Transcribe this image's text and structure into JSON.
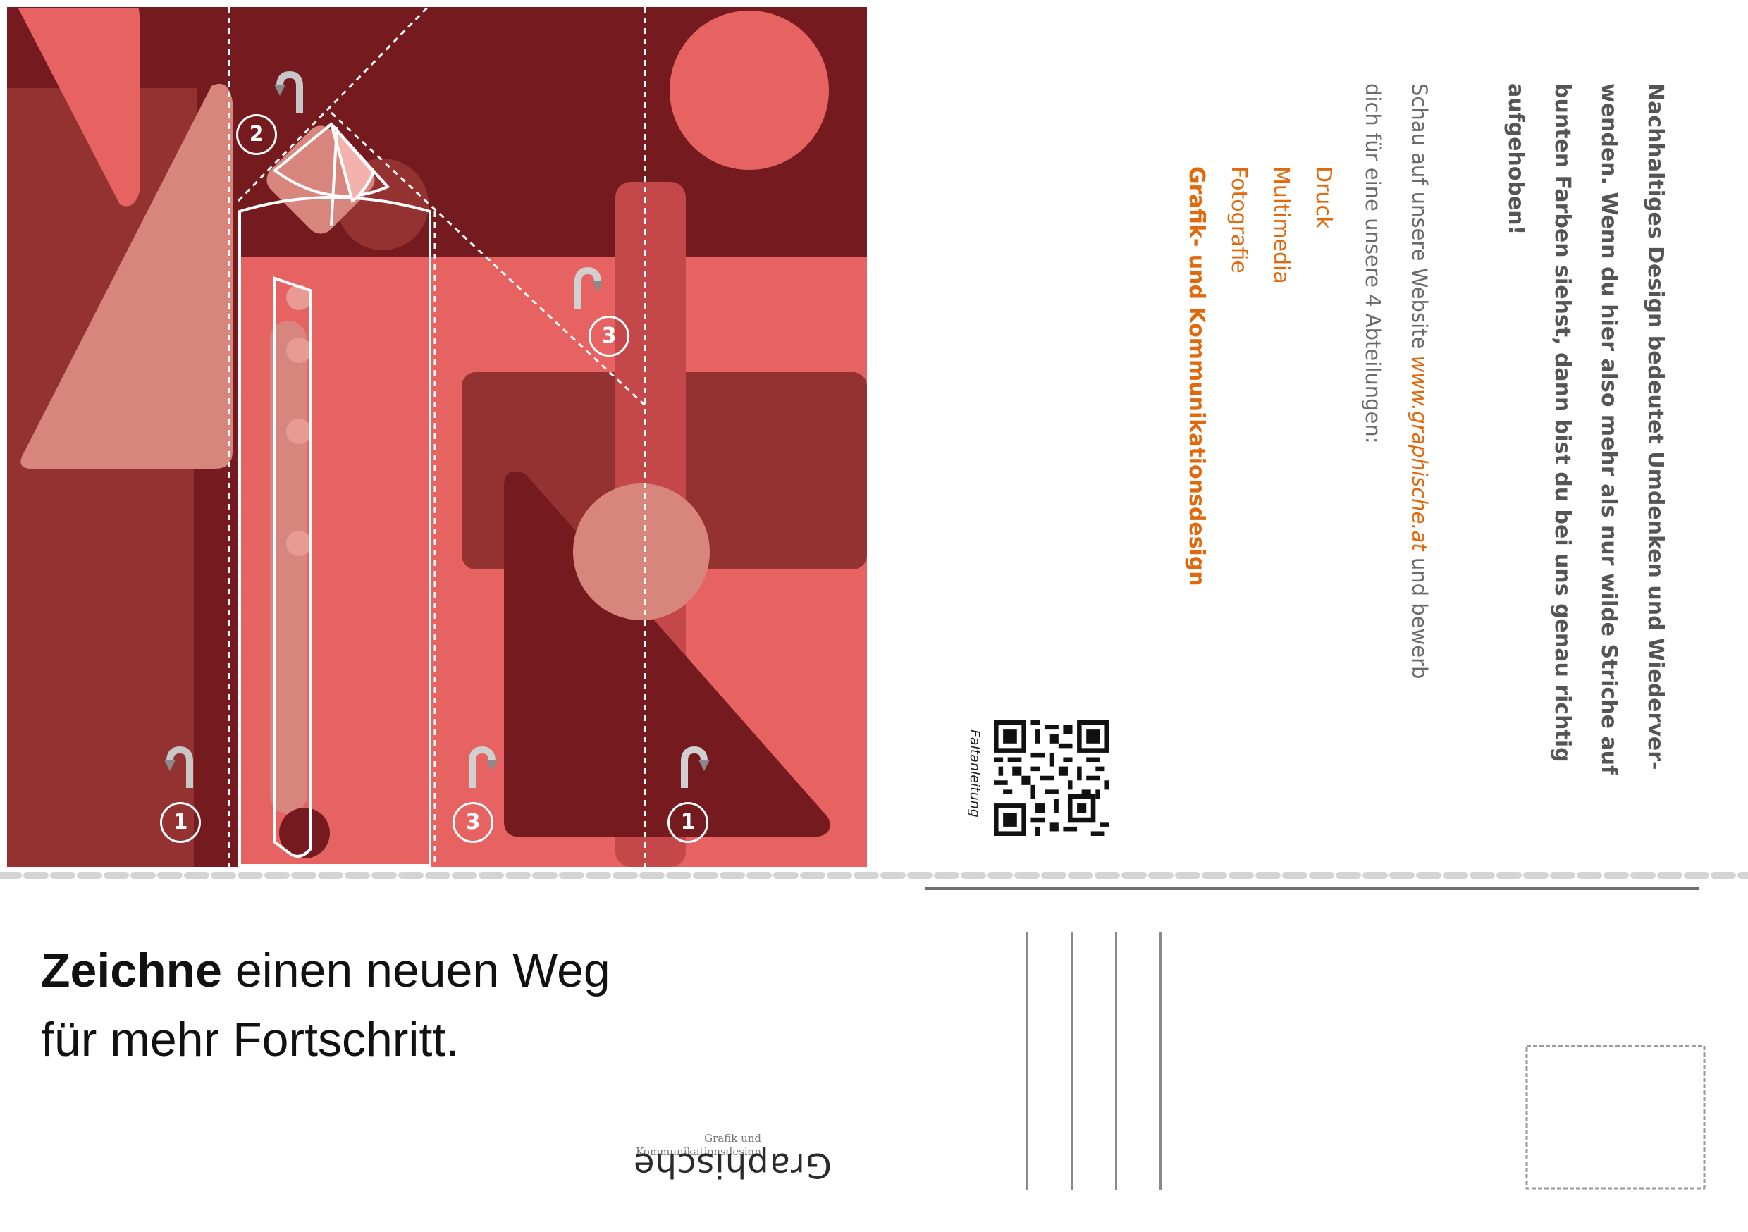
{
  "colors": {
    "dark_red": "#751a1f",
    "mid_red": "#943131",
    "salmon": "#e66362",
    "pink": "#d8857e",
    "bar_red": "#c44749",
    "orange_accent": "#e0690e",
    "grey_text": "#555558"
  },
  "fold_steps": [
    {
      "number": "2",
      "icon": "rotate-arrow-icon"
    },
    {
      "number": "3",
      "icon": "rotate-arrow-icon"
    },
    {
      "number": "1",
      "icon": "rotate-arrow-icon"
    },
    {
      "number": "3",
      "icon": "rotate-arrow-icon"
    },
    {
      "number": "1",
      "icon": "rotate-arrow-icon"
    }
  ],
  "info": {
    "paragraph_lines": [
      "Nachhaltiges Design bedeutet Umdenken und Wiederver-",
      "wenden. Wenn du hier also mehr als nur wilde Striche auf",
      "bunten Farben siehst, dann bist du bei uns genau richtig",
      "aufgehoben!"
    ],
    "website_prefix": "Schau auf unsere Website ",
    "website_url": "www.graphische.at",
    "website_suffix": " und bewerb",
    "website_line2": "dich für eine unsere 4 Abteilungen:",
    "departments": [
      "Druck",
      "Multimedia",
      "Fotografie",
      "Grafik- und Kommunikationsdesign"
    ]
  },
  "qr": {
    "label": "Faltanleitung"
  },
  "headline": {
    "bold": "Zeichne",
    "rest_line1": " einen neuen Weg",
    "line2": "für mehr Fortschritt."
  },
  "logo": {
    "subtitle_line1": "Grafik und",
    "subtitle_line2": "Kommunikationsdesign",
    "wordmark": "Graphische"
  }
}
